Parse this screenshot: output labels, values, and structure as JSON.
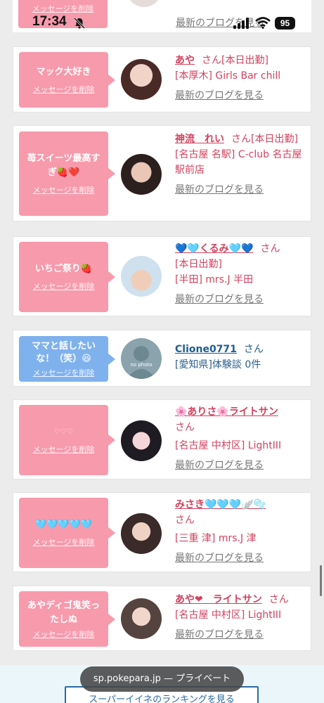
{
  "status_bar": {
    "time": "17:34",
    "battery": "95",
    "icons": [
      "bell-slash-icon",
      "signal-icon",
      "wifi-icon",
      "battery-icon"
    ]
  },
  "partial_card": {
    "delete_label": "メッセージを削除",
    "blog_link": "最新のブログを見る"
  },
  "entries": [
    {
      "message": "マック大好き",
      "delete_label": "メッセージを削除",
      "name": "あや",
      "san": "さん",
      "suffix": "[本日出勤]",
      "details": [
        "[本厚木] Girls Bar chill"
      ],
      "blog_link": "最新のブログを見る",
      "bubble_color": "pink"
    },
    {
      "message": "苺スイーツ最高すぎ🍓❤️",
      "delete_label": "メッセージを削除",
      "name": "神流　れい",
      "san": "さん",
      "suffix": "[本日出勤]",
      "details": [
        "[名古屋 名駅] C-club 名古屋駅前店"
      ],
      "blog_link": "最新のブログを見る",
      "bubble_color": "pink"
    },
    {
      "message": "いちご祭り🍓",
      "delete_label": "メッセージを削除",
      "name": "💙🩵くるみ🩵💙",
      "san": "さん",
      "suffix": "",
      "details": [
        "[本日出勤]",
        "[半田] mrs.J 半田"
      ],
      "blog_link": "最新のブログを見る",
      "bubble_color": "pink"
    },
    {
      "message": "ママと話したいな！（笑）😆",
      "delete_label": "メッセージを削除",
      "name": "Clione0771",
      "san": "さん",
      "suffix": "",
      "details": [
        "[愛知県]体験談 0件"
      ],
      "blog_link": "",
      "bubble_color": "blue",
      "avatar_text": "no photo"
    },
    {
      "message": "♡♡♡",
      "delete_label": "メッセージを削除",
      "name": "🌸ありさ🌸ライトサン",
      "san": "さん",
      "suffix": "",
      "details": [
        "[名古屋 中村区] LightIII"
      ],
      "blog_link": "最新のブログを見る",
      "bubble_color": "pink"
    },
    {
      "message": "🩵🩵🩵🩵🩵",
      "delete_label": "メッセージを削除",
      "name": "みさき🩵🩵🩵🪽🫧",
      "san": "さん",
      "suffix": "",
      "details": [
        "[三重 津] mrs.J 津"
      ],
      "blog_link": "最新のブログを見る",
      "bubble_color": "pink"
    },
    {
      "message": "あやディゴ鬼笑ったしぬ",
      "delete_label": "メッセージを削除",
      "name": "あや❤︎　ライトサン",
      "san": "さん",
      "suffix": "",
      "details": [
        "[名古屋 中村区] LightIII"
      ],
      "blog_link": "最新のブログを見る",
      "bubble_color": "pink"
    }
  ],
  "bottom": {
    "url": "sp.pokepara.jp — プライベート",
    "ranking_button": "スーパーイイネのランキングを見る"
  },
  "colors": {
    "bubble_pink": "#f79aac",
    "bubble_blue": "#7fb1ed",
    "name_pink": "#d4415e",
    "name_blue": "#1f5d91"
  }
}
